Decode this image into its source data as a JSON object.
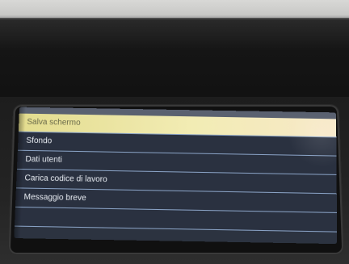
{
  "menu": {
    "items": [
      {
        "label": "Salva schermo",
        "selected": true
      },
      {
        "label": "Sfondo",
        "selected": false
      },
      {
        "label": "Dati utenti",
        "selected": false
      },
      {
        "label": "Carica codice di lavoro",
        "selected": false
      },
      {
        "label": "Messaggio breve",
        "selected": false
      }
    ]
  },
  "colors": {
    "screen_background": "#2c3340",
    "selection_highlight": "#efe8a6",
    "divider": "#8aa3c6",
    "text": "#e9edf3"
  }
}
